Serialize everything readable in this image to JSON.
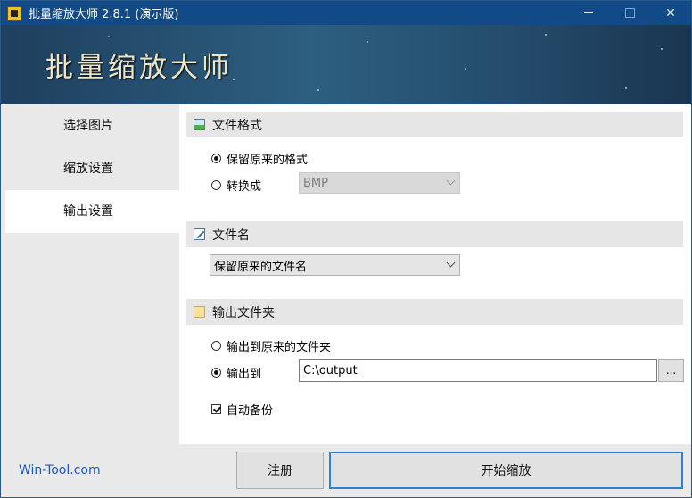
{
  "window": {
    "title": "批量缩放大师 2.8.1 (演示版)",
    "controls": {
      "minimize": "—",
      "maximize": "□",
      "close": "✕"
    }
  },
  "banner": {
    "title": "批量缩放大师"
  },
  "sidebar": {
    "items": [
      {
        "label": "选择图片",
        "active": false
      },
      {
        "label": "缩放设置",
        "active": false
      },
      {
        "label": "输出设置",
        "active": true
      }
    ]
  },
  "format_section": {
    "title": "文件格式",
    "icon": "image-icon",
    "keep_label": "保留原来的格式",
    "keep_checked": true,
    "convert_label": "转换成",
    "convert_checked": false,
    "convert_select": "BMP"
  },
  "filename_section": {
    "title": "文件名",
    "icon": "edit-icon",
    "select_value": "保留原来的文件名"
  },
  "output_section": {
    "title": "输出文件夹",
    "icon": "folder-icon",
    "original_label": "输出到原来的文件夹",
    "original_checked": false,
    "to_label": "输出到",
    "to_checked": true,
    "path_value": "C:\\output",
    "browse_label": "...",
    "backup_label": "自动备份",
    "backup_checked": true
  },
  "footer": {
    "link": "Win-Tool.com",
    "register_button": "注册",
    "start_button": "开始缩放"
  },
  "colors": {
    "titlebar": "#124a87",
    "link": "#1a56c4",
    "primary_border": "#2f7fd1"
  }
}
